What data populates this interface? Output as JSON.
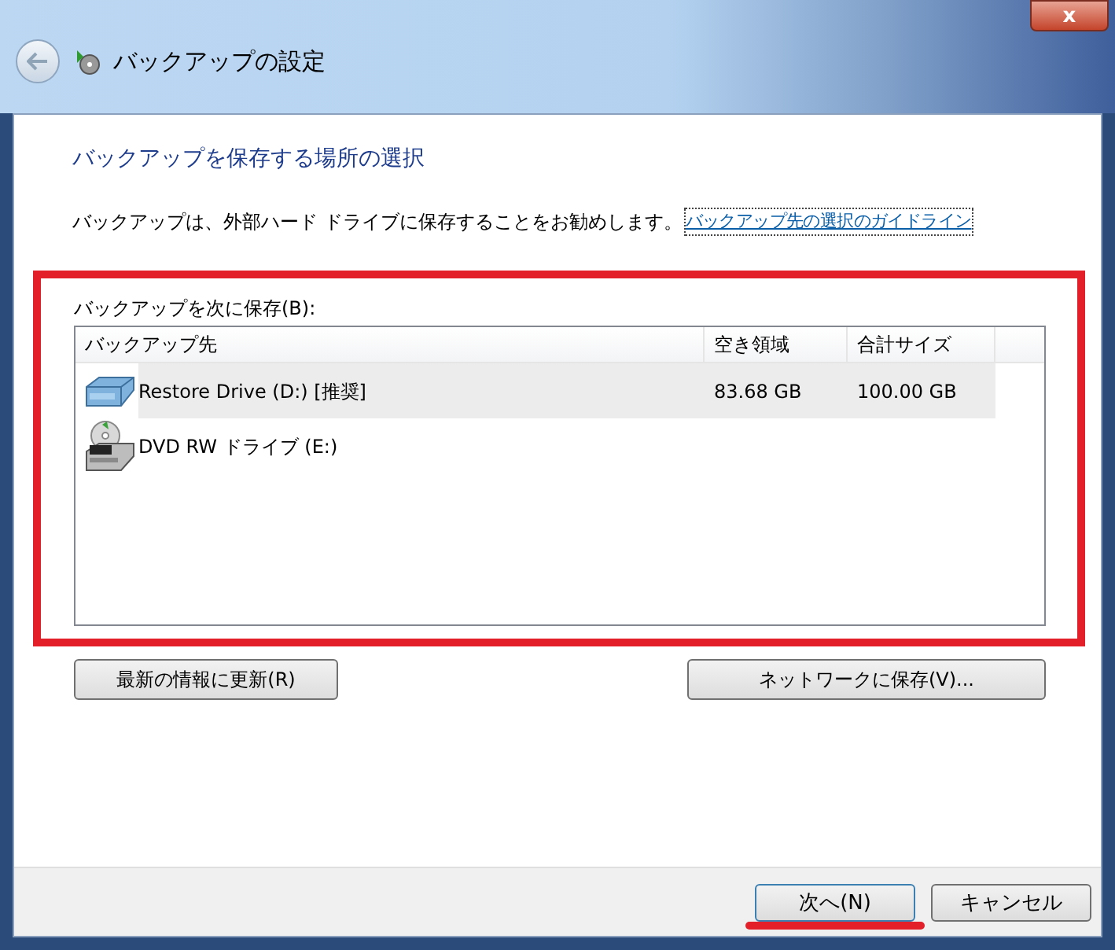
{
  "window": {
    "title": "バックアップの設定",
    "close": "x"
  },
  "heading": "バックアップを保存する場所の選択",
  "description": "バックアップは、外部ハード ドライブに保存することをお勧めします。",
  "guide_link": "バックアップ先の選択のガイドライン",
  "list_label": "バックアップを次に保存(B):",
  "table": {
    "columns": [
      "バックアップ先",
      "空き領域",
      "合計サイズ"
    ],
    "rows": [
      {
        "kind": "hdd",
        "name": "Restore Drive (D:) [推奨]",
        "free": "83.68 GB",
        "total": "100.00 GB",
        "selected": true
      },
      {
        "kind": "dvd",
        "name": "DVD RW ドライブ (E:)",
        "free": "",
        "total": "",
        "selected": false
      }
    ]
  },
  "refresh_button": "最新の情報に更新(R)",
  "network_button": "ネットワークに保存(V)...",
  "buttons": [
    "次へ(N)",
    "キャンセル"
  ]
}
